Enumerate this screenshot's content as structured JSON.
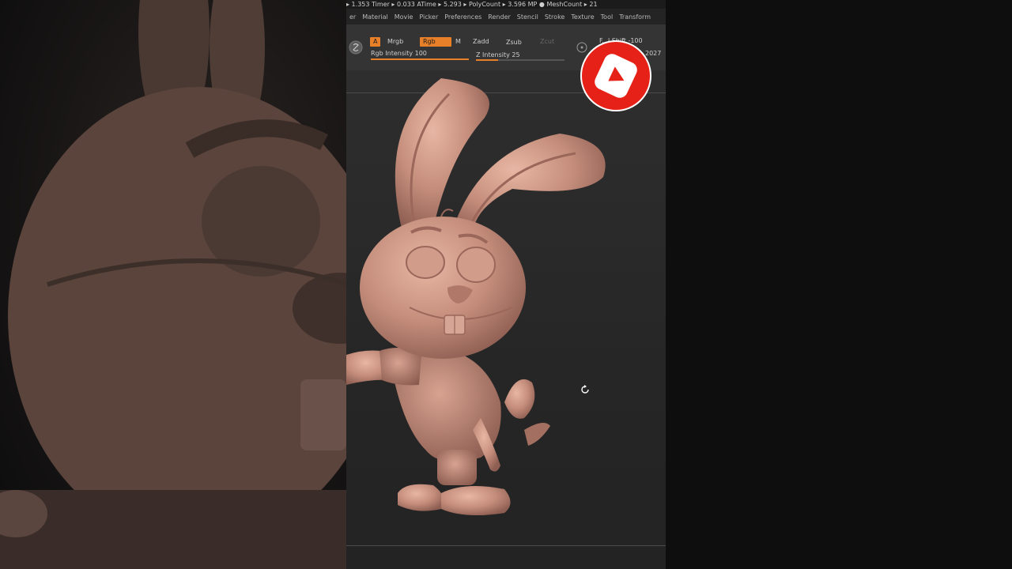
{
  "status_bar": {
    "text": "▸ 1.353 Timer ▸ 0.033 ATime ▸ 5.293 ▸ PolyCount ▸ 3.596 MP ● MeshCount ▸ 21"
  },
  "menu": {
    "items": [
      "er",
      "Material",
      "Movie",
      "Picker",
      "Preferences",
      "Render",
      "Stencil",
      "Stroke",
      "Texture",
      "Tool",
      "Transform"
    ]
  },
  "toolbar": {
    "a_label": "A",
    "mrgb_label": "Mrgb",
    "rgb_label": "Rgb",
    "m_label": "M",
    "zadd_label": "Zadd",
    "zsub_label": "Zsub",
    "zcut_label": "Zcut",
    "rgb_intensity": {
      "label": "Rgb Intensity 100",
      "value": 100
    },
    "z_intensity": {
      "label": "Z Intensity 25",
      "value": 25
    },
    "focal_shift": "F...l Shift -100",
    "draw_size": "2027"
  },
  "colors": {
    "accent": "#e8802a",
    "clay": "#c99080",
    "youtube_red": "#e62117"
  },
  "icons": {
    "material_sphere": "material-sphere-icon",
    "rotate_cursor": "rotate-cursor-icon",
    "youtube": "youtube-play-icon"
  }
}
